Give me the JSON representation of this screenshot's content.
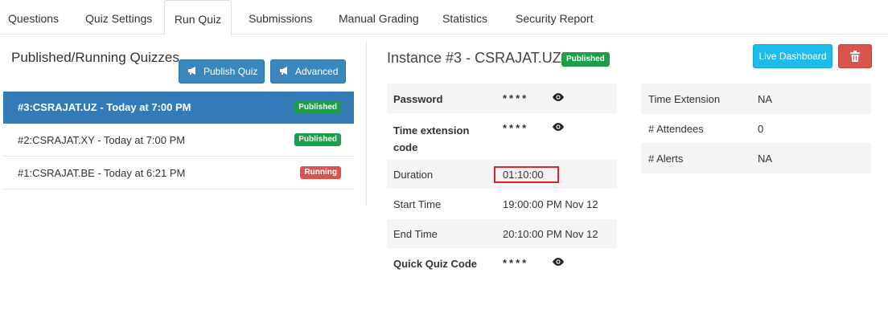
{
  "tabs": [
    {
      "label": "Questions"
    },
    {
      "label": "Quiz Settings"
    },
    {
      "label": "Run Quiz",
      "active": true
    },
    {
      "label": "Submissions"
    },
    {
      "label": "Manual Grading"
    },
    {
      "label": "Statistics"
    },
    {
      "label": "Security Report"
    }
  ],
  "left": {
    "title": "Published/Running Quizzes",
    "publish_btn": "Publish Quiz",
    "advanced_btn": "Advanced",
    "quizzes": [
      {
        "label": "#3:CSRAJAT.UZ - Today at 7:00 PM",
        "status": "Published",
        "status_color": "#1e9e4a"
      },
      {
        "label": "#2:CSRAJAT.XY - Today at 7:00 PM",
        "status": "Published",
        "status_color": "#1e9e4a"
      },
      {
        "label": "#1:CSRAJAT.BE - Today at 6:21 PM",
        "status": "Running",
        "status_color": "#d9534f"
      }
    ]
  },
  "instance": {
    "title": "Instance #3 - CSRAJAT.UZ",
    "status": "Published",
    "live_dashboard": "Live Dashboard",
    "details": [
      {
        "label": "Password",
        "value": "****",
        "masked": true
      },
      {
        "label": "Time extension code",
        "value": "****",
        "masked": true
      },
      {
        "label": "Duration",
        "value": "01:10:00"
      },
      {
        "label": "Start Time",
        "value": "19:00:00 PM Nov 12"
      },
      {
        "label": "End Time",
        "value": "20:10:00 PM Nov 12"
      },
      {
        "label": "Quick Quiz Code",
        "value": "****",
        "masked": true
      }
    ],
    "stats": [
      {
        "label": "Time Extension",
        "value": "NA"
      },
      {
        "label": "# Attendees",
        "value": "0"
      },
      {
        "label": "# Alerts",
        "value": "NA"
      }
    ]
  },
  "colors": {
    "primary": "#337ab7",
    "success": "#1e9e4a",
    "danger": "#d9534f",
    "info": "#1ebcea"
  }
}
